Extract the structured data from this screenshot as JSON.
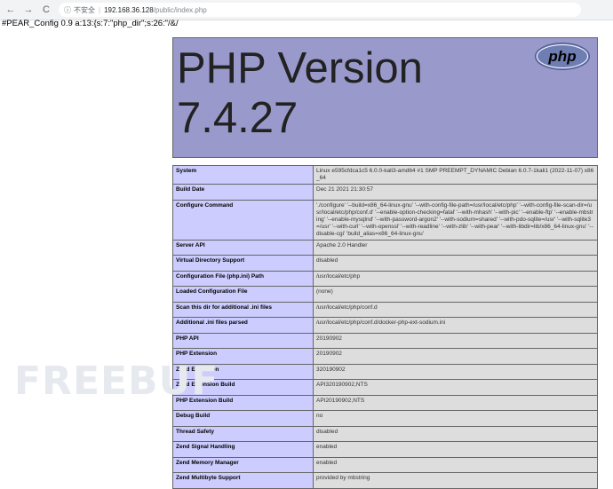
{
  "browser": {
    "back_icon": "←",
    "forward_icon": "→",
    "reload_icon": "C",
    "info_icon": "ⓘ",
    "security_label": "不安全",
    "separator": "|",
    "host": "192.168.36.128",
    "path": "/public/index.php"
  },
  "raw_output": "#PEAR_Config 0.9 a:13:{s:7:\"php_dir\";s:26:\"/&/",
  "banner": {
    "title_line1": "PHP Version",
    "title_line2": "7.4.27",
    "logo_text": "php"
  },
  "info_rows": [
    {
      "key": "System",
      "value": "Linux e595cfdca1c5 6.0.0-kali3-amd64 #1 SMP PREEMPT_DYNAMIC Debian 6.0.7-1kali1 (2022-11-07) x86_64"
    },
    {
      "key": "Build Date",
      "value": "Dec 21 2021 21:30:57"
    },
    {
      "key": "Configure Command",
      "value": "'./configure' '--build=x86_64-linux-gnu' '--with-config-file-path=/usr/local/etc/php' '--with-config-file-scan-dir=/usr/local/etc/php/conf.d' '--enable-option-checking=fatal' '--with-mhash' '--with-pic' '--enable-ftp' '--enable-mbstring' '--enable-mysqlnd' '--with-password-argon2' '--with-sodium=shared' '--with-pdo-sqlite=/usr' '--with-sqlite3=/usr' '--with-curl' '--with-openssl' '--with-readline' '--with-zlib' '--with-pear' '--with-libdir=lib/x86_64-linux-gnu' '--disable-cgi' 'build_alias=x86_64-linux-gnu'"
    },
    {
      "key": "Server API",
      "value": "Apache 2.0 Handler"
    },
    {
      "key": "Virtual Directory Support",
      "value": "disabled"
    },
    {
      "key": "Configuration File (php.ini) Path",
      "value": "/usr/local/etc/php"
    },
    {
      "key": "Loaded Configuration File",
      "value": "(none)"
    },
    {
      "key": "Scan this dir for additional .ini files",
      "value": "/usr/local/etc/php/conf.d"
    },
    {
      "key": "Additional .ini files parsed",
      "value": "/usr/local/etc/php/conf.d/docker-php-ext-sodium.ini"
    },
    {
      "key": "PHP API",
      "value": "20190902"
    },
    {
      "key": "PHP Extension",
      "value": "20190902"
    },
    {
      "key": "Zend Extension",
      "value": "320190902"
    },
    {
      "key": "Zend Extension Build",
      "value": "API320190902,NTS"
    },
    {
      "key": "PHP Extension Build",
      "value": "API20190902,NTS"
    },
    {
      "key": "Debug Build",
      "value": "no"
    },
    {
      "key": "Thread Safety",
      "value": "disabled"
    },
    {
      "key": "Zend Signal Handling",
      "value": "enabled"
    },
    {
      "key": "Zend Memory Manager",
      "value": "enabled"
    },
    {
      "key": "Zend Multibyte Support",
      "value": "provided by mbstring"
    }
  ],
  "watermark": "FREEBUF",
  "colors": {
    "banner_bg": "#9999cc",
    "key_cell_bg": "#ccccff",
    "value_cell_bg": "#dddddd",
    "border": "#666666"
  }
}
